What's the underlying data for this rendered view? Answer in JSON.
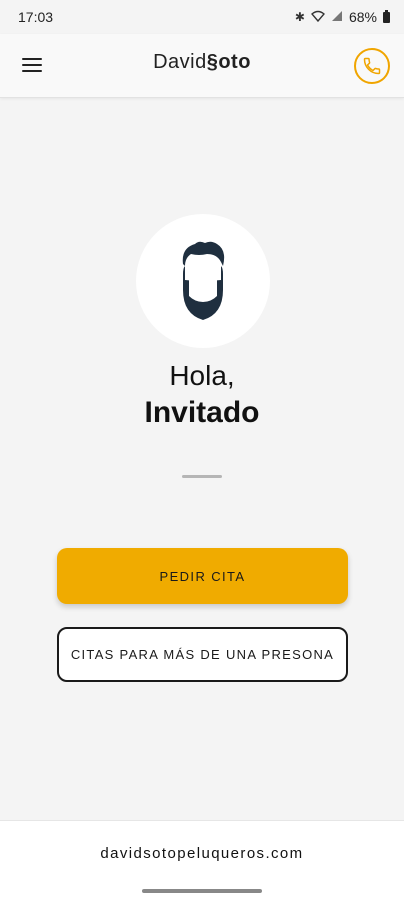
{
  "status_bar": {
    "time": "17:03",
    "battery": "68%",
    "icons": [
      "bluetooth-icon",
      "wifi-icon",
      "signal-icon",
      "battery-icon"
    ]
  },
  "app_bar": {
    "brand_first": "David",
    "brand_last": "§oto",
    "menu_icon": "hamburger-menu-icon",
    "phone_icon": "phone-icon",
    "accent_color": "#f0a500"
  },
  "profile": {
    "avatar_icon": "bearded-man-avatar-icon",
    "greeting": "Hola,",
    "name": "Invitado"
  },
  "actions": {
    "primary_label": "PEDIR CITA",
    "secondary_label": "CITAS PARA MÁS DE UNA PRESONA",
    "primary_color": "#f0ab00"
  },
  "footer": {
    "website": "davidsotopeluqueros.com"
  }
}
